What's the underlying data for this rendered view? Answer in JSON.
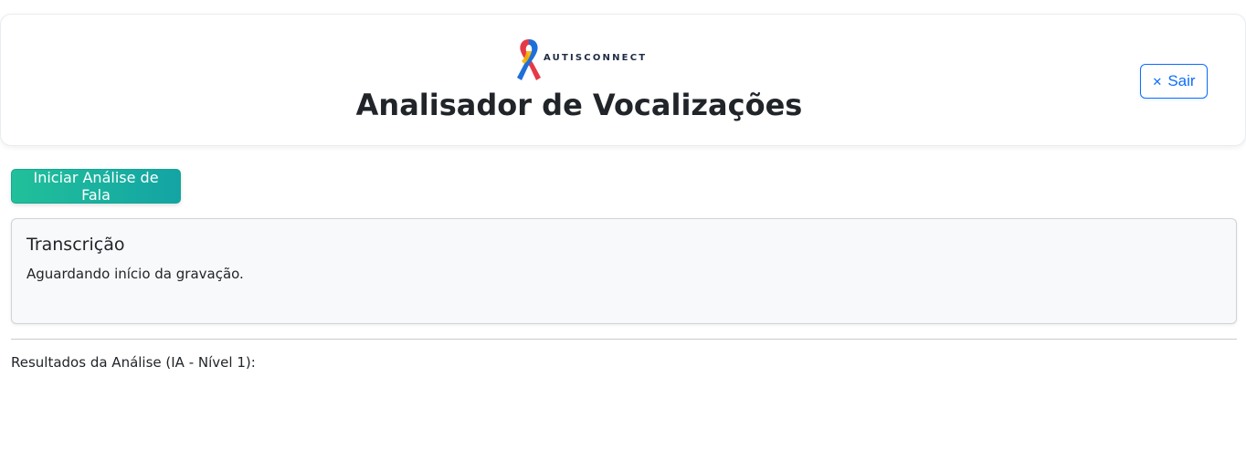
{
  "header": {
    "logo_text": "AUTISCONNECT",
    "title": "Analisador de Vocalizações",
    "exit_icon": "close-icon",
    "exit_label": "Sair"
  },
  "actions": {
    "start_label": "Iniciar Análise de Fala"
  },
  "transcript": {
    "title": "Transcrição",
    "status_text": "Aguardando início da gravação."
  },
  "results": {
    "label": "Resultados da Análise (IA - Nível 1):"
  },
  "colors": {
    "primary": "#0d6efd",
    "start_gradient_start": "#21c09a",
    "start_gradient_end": "#13a4a4",
    "ribbon_red": "#e63946",
    "ribbon_yellow": "#f4b400",
    "ribbon_blue": "#1e6fd9"
  }
}
